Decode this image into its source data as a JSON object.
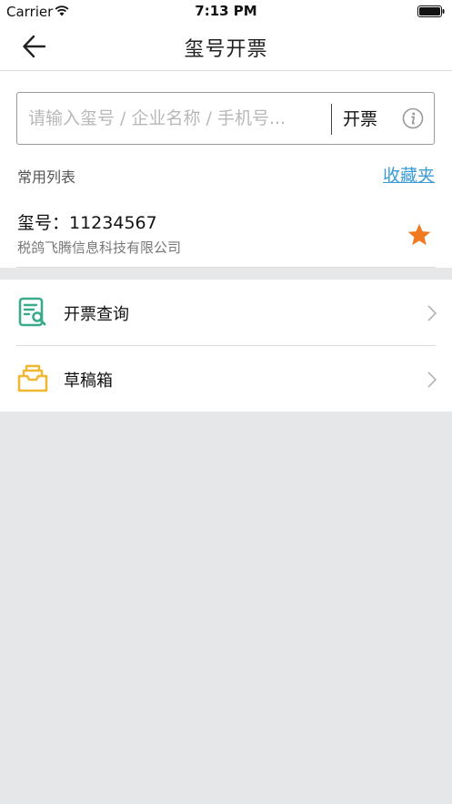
{
  "status_bar": {
    "carrier": "Carrier",
    "time": "7:13 PM"
  },
  "nav": {
    "title": "玺号开票",
    "back_icon": "arrow-left-icon"
  },
  "search": {
    "placeholder": "请输入玺号 / 企业名称 / 手机号...",
    "value": "",
    "issue_button": "开票",
    "info_icon": "info-icon"
  },
  "favorites": {
    "section_label": "常用列表",
    "link_label": "收藏夹",
    "link_color": "#3a9bd5",
    "items": [
      {
        "tax_number": "玺号：11234567",
        "company": "税鸽飞腾信息科技有限公司",
        "starred": true,
        "star_color": "#f07a22"
      }
    ]
  },
  "menu": {
    "items": [
      {
        "label": "开票查询",
        "icon": "invoice-search-icon",
        "icon_color": "#3aab8a"
      },
      {
        "label": "草稿箱",
        "icon": "drafts-box-icon",
        "icon_color": "#f0b732"
      }
    ]
  },
  "colors": {
    "page_background": "#e6e7e9",
    "divider": "#dcdcdc"
  }
}
